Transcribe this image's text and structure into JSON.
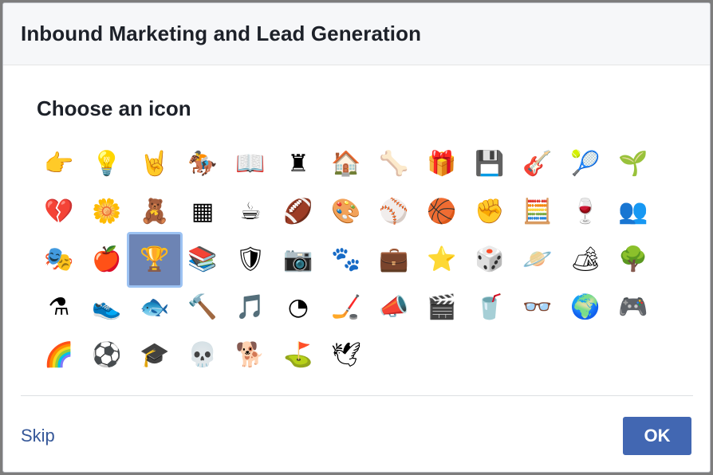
{
  "dialog": {
    "title": "Inbound Marketing and Lead Generation",
    "section_title": "Choose an icon",
    "selected_index": 28,
    "icons": [
      {
        "name": "pointing-hand-icon",
        "glyph": "👉"
      },
      {
        "name": "light-bulb-icon",
        "glyph": "💡"
      },
      {
        "name": "rock-hand-icon",
        "glyph": "🤘"
      },
      {
        "name": "horse-racing-icon",
        "glyph": "🏇"
      },
      {
        "name": "open-book-icon",
        "glyph": "📖"
      },
      {
        "name": "chess-rook-icon",
        "glyph": "♜"
      },
      {
        "name": "house-icon",
        "glyph": "🏠"
      },
      {
        "name": "bone-icon",
        "glyph": "🦴"
      },
      {
        "name": "gift-icon",
        "glyph": "🎁"
      },
      {
        "name": "computer-chip-icon",
        "glyph": "💾"
      },
      {
        "name": "guitar-icon",
        "glyph": "🎸"
      },
      {
        "name": "tennis-icon",
        "glyph": "🎾"
      },
      {
        "name": "seedling-icon",
        "glyph": "🌱"
      },
      {
        "name": "broken-heart-icon",
        "glyph": "💔"
      },
      {
        "name": "flower-icon",
        "glyph": "🌼"
      },
      {
        "name": "teddy-bear-icon",
        "glyph": "🧸"
      },
      {
        "name": "calendar-grid-icon",
        "glyph": "▦"
      },
      {
        "name": "coffee-icon",
        "glyph": "☕"
      },
      {
        "name": "football-icon",
        "glyph": "🏈"
      },
      {
        "name": "palette-icon",
        "glyph": "🎨"
      },
      {
        "name": "baseball-icon",
        "glyph": "⚾"
      },
      {
        "name": "basketball-icon",
        "glyph": "🏀"
      },
      {
        "name": "raised-fist-icon",
        "glyph": "✊"
      },
      {
        "name": "calculator-icon",
        "glyph": "🧮"
      },
      {
        "name": "wine-glass-icon",
        "glyph": "🍷"
      },
      {
        "name": "group-icon",
        "glyph": "👥"
      },
      {
        "name": "theater-masks-icon",
        "glyph": "🎭"
      },
      {
        "name": "apple-icon",
        "glyph": "🍎"
      },
      {
        "name": "trophy-icon",
        "glyph": "🏆"
      },
      {
        "name": "bookshelf-icon",
        "glyph": "📚"
      },
      {
        "name": "shield-icon",
        "glyph": "🛡"
      },
      {
        "name": "camera-icon",
        "glyph": "📷"
      },
      {
        "name": "paw-icon",
        "glyph": "🐾"
      },
      {
        "name": "briefcase-icon",
        "glyph": "💼"
      },
      {
        "name": "star-icon",
        "glyph": "⭐"
      },
      {
        "name": "dice-icon",
        "glyph": "🎲"
      },
      {
        "name": "planet-icon",
        "glyph": "🪐"
      },
      {
        "name": "night-camp-icon",
        "glyph": "🏕"
      },
      {
        "name": "tree-icon",
        "glyph": "🌳"
      },
      {
        "name": "flask-icon",
        "glyph": "⚗"
      },
      {
        "name": "sneaker-icon",
        "glyph": "👟"
      },
      {
        "name": "fish-icon",
        "glyph": "🐟"
      },
      {
        "name": "gavel-icon",
        "glyph": "🔨"
      },
      {
        "name": "music-note-icon",
        "glyph": "🎵"
      },
      {
        "name": "pie-chart-icon",
        "glyph": "◔"
      },
      {
        "name": "hockey-puck-icon",
        "glyph": "🏒"
      },
      {
        "name": "megaphone-icon",
        "glyph": "📣"
      },
      {
        "name": "clapper-board-icon",
        "glyph": "🎬"
      },
      {
        "name": "red-cup-icon",
        "glyph": "🥤"
      },
      {
        "name": "glasses-icon",
        "glyph": "👓"
      },
      {
        "name": "globe-icon",
        "glyph": "🌍"
      },
      {
        "name": "game-controller-icon",
        "glyph": "🎮"
      },
      {
        "name": "rainbow-icon",
        "glyph": "🌈"
      },
      {
        "name": "soccer-ball-icon",
        "glyph": "⚽"
      },
      {
        "name": "graduation-cap-icon",
        "glyph": "🎓"
      },
      {
        "name": "skull-icon",
        "glyph": "💀"
      },
      {
        "name": "dog-coin-icon",
        "glyph": "🐕"
      },
      {
        "name": "golf-flag-icon",
        "glyph": "⛳"
      },
      {
        "name": "dove-icon",
        "glyph": "🕊"
      }
    ]
  },
  "footer": {
    "skip_label": "Skip",
    "ok_label": "OK"
  },
  "colors": {
    "primary": "#4267b2",
    "link": "#365899",
    "selected_bg": "#6d84b4",
    "selected_border": "#9cc2f2"
  }
}
